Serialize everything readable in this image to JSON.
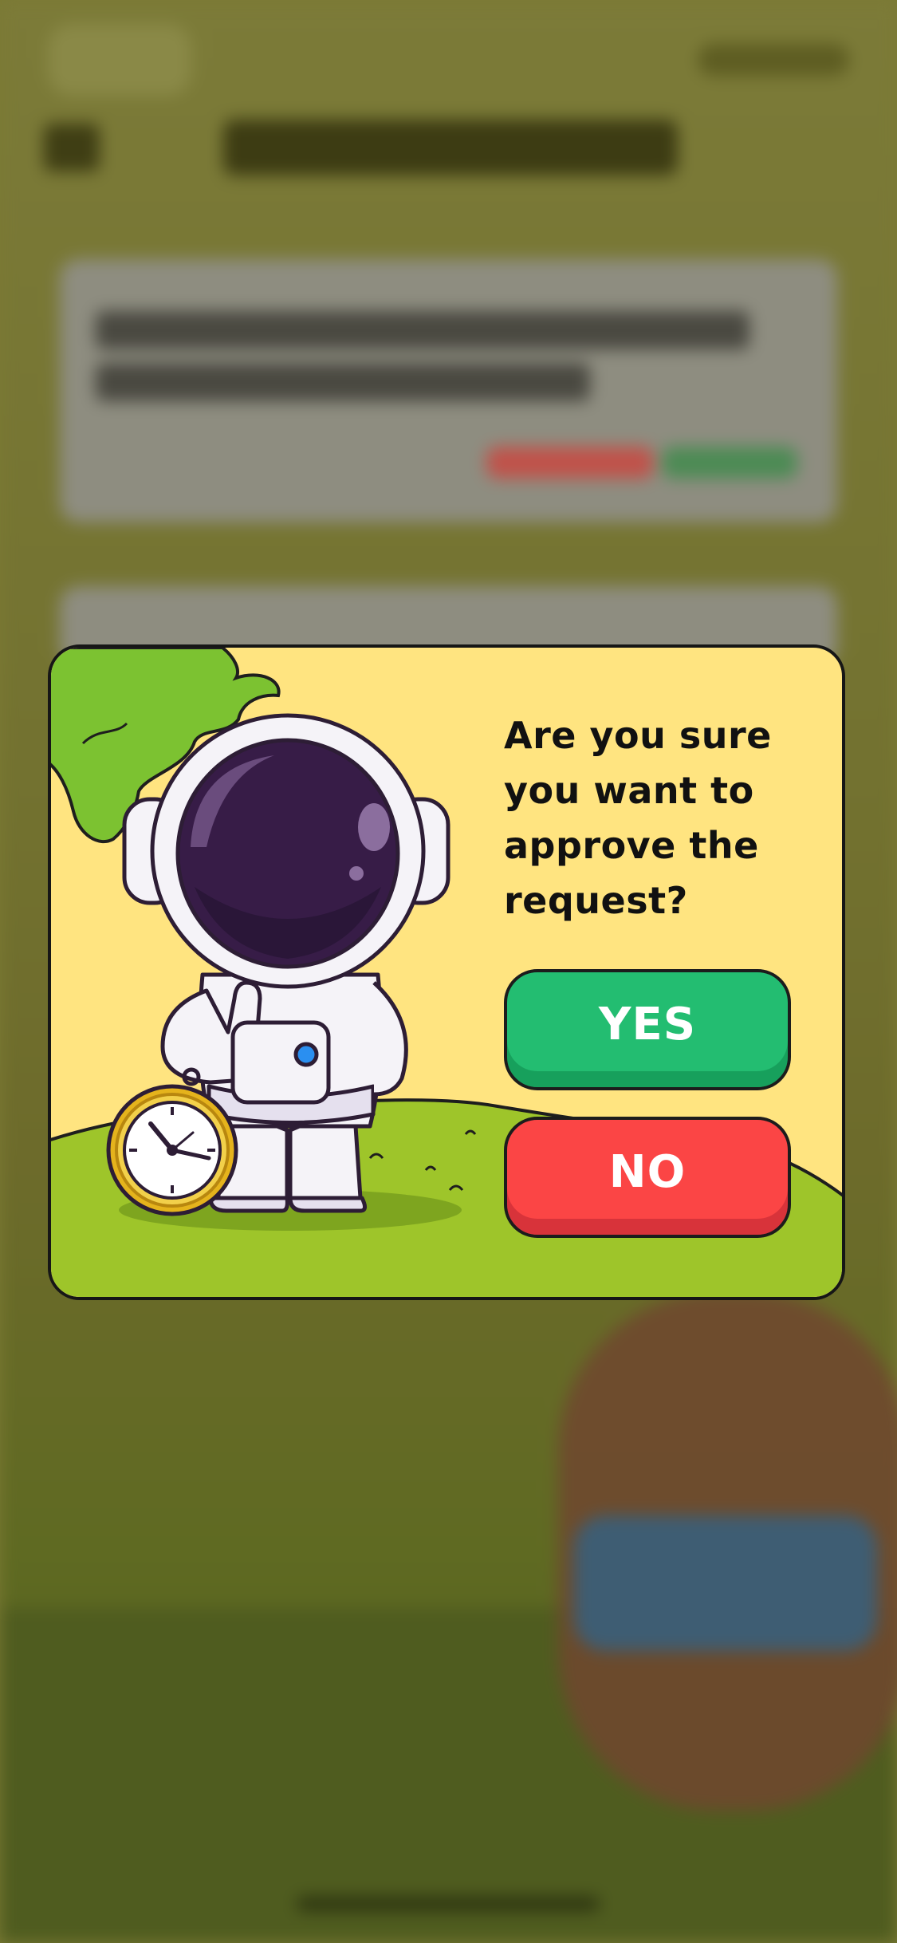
{
  "dialog": {
    "message": "Are you sure you want to approve the request?",
    "yes_label": "YES",
    "no_label": "NO"
  },
  "illustration": {
    "subject": "astronaut-thumbs-up-with-pocket-watch",
    "icons": [
      "astronaut-icon",
      "pocket-watch-icon",
      "tree-icon"
    ]
  },
  "colors": {
    "dialog_background": "#ffe480",
    "yes_button": "#23bd71",
    "no_button": "#fb4545",
    "grass": "#9ec52a",
    "tree": "#7cc231",
    "helmet_visor": "#371c47",
    "watch_gold": "#e5b31c"
  }
}
